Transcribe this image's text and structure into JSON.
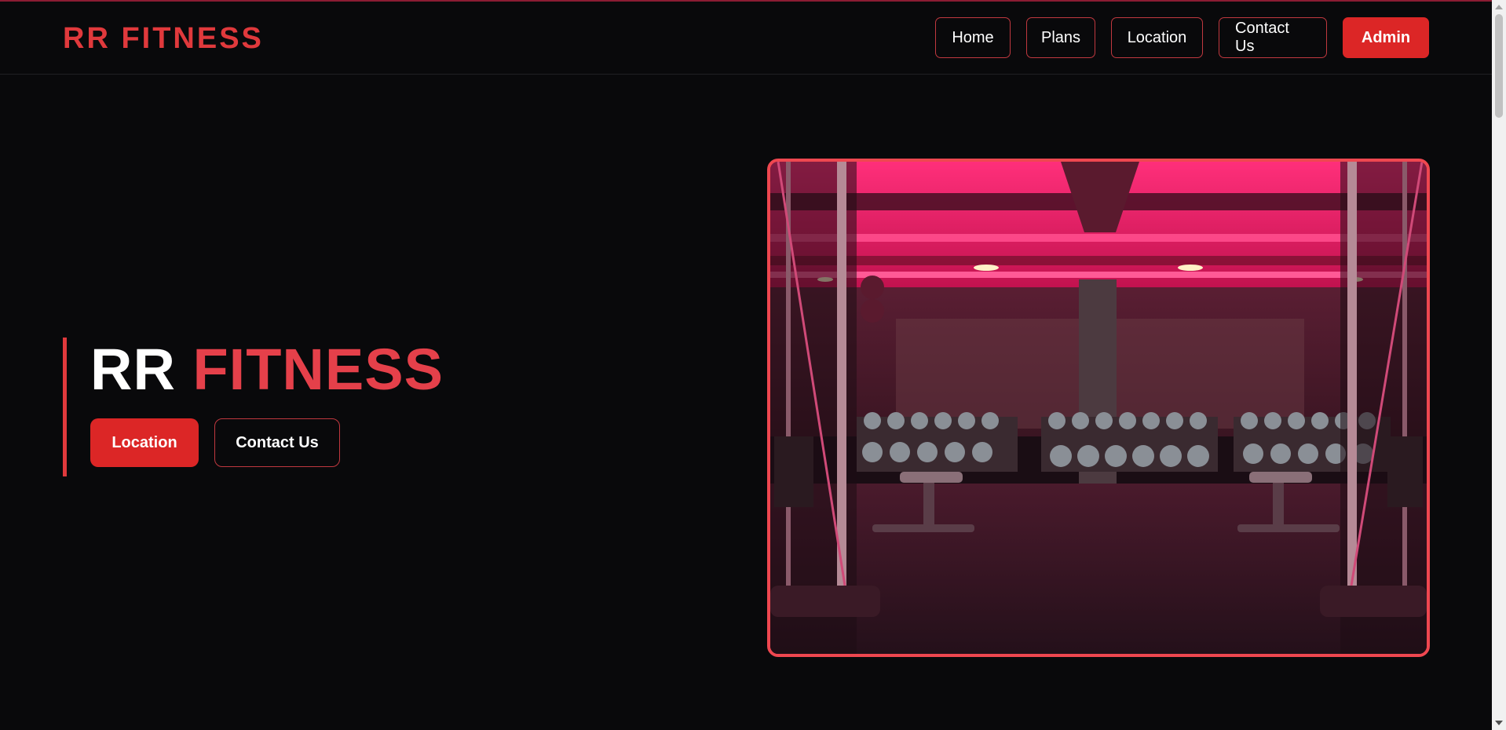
{
  "brand": {
    "name": "RR FITNESS"
  },
  "nav": {
    "home": "Home",
    "plans": "Plans",
    "location": "Location",
    "contact": "Contact Us",
    "admin": "Admin"
  },
  "hero": {
    "title_part1": "RR",
    "title_part2": "FITNESS",
    "primary_button": "Location",
    "secondary_button": "Contact Us"
  },
  "colors": {
    "accent": "#e0393c",
    "button_red": "#dc2626",
    "background": "#09090b",
    "image_tone": "#e8185a"
  },
  "icons": {
    "scroll_up": "chevron-up-icon",
    "scroll_down": "chevron-down-icon"
  }
}
